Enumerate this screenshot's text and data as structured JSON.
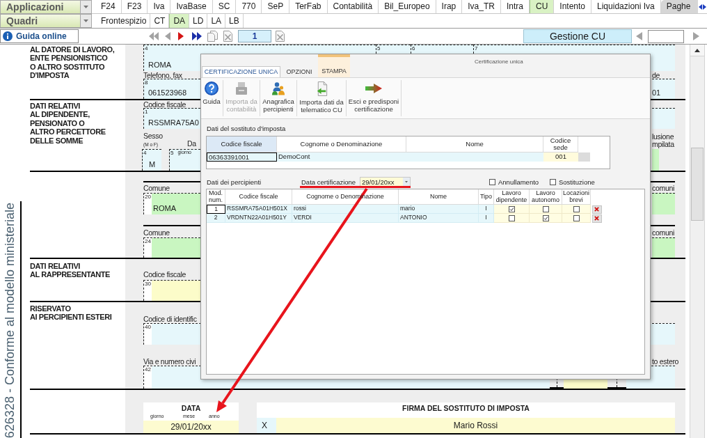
{
  "menu_bar": {
    "selector": "Applicazioni",
    "tabs": [
      {
        "label": "F24",
        "selected": false,
        "highlighted": false
      },
      {
        "label": "F23",
        "selected": false,
        "highlighted": false
      },
      {
        "label": "Iva",
        "selected": false,
        "highlighted": false
      },
      {
        "label": "IvaBase",
        "selected": false,
        "highlighted": false
      },
      {
        "label": "SC",
        "selected": false,
        "highlighted": false
      },
      {
        "label": "770",
        "selected": false,
        "highlighted": false
      },
      {
        "label": "SeP",
        "selected": false,
        "highlighted": false
      },
      {
        "label": "TerFab",
        "selected": false,
        "highlighted": false
      },
      {
        "label": "Contabilità",
        "selected": false,
        "highlighted": false
      },
      {
        "label": "Bil_Europeo",
        "selected": false,
        "highlighted": false
      },
      {
        "label": "Irap",
        "selected": false,
        "highlighted": false
      },
      {
        "label": "Iva_TR",
        "selected": false,
        "highlighted": false
      },
      {
        "label": "Intra",
        "selected": false,
        "highlighted": false
      },
      {
        "label": "CU",
        "selected": true,
        "highlighted": false
      },
      {
        "label": "Intento",
        "selected": false,
        "highlighted": false
      },
      {
        "label": "Liquidazioni Iva",
        "selected": false,
        "highlighted": false
      },
      {
        "label": "Paghe",
        "selected": false,
        "highlighted": true
      }
    ]
  },
  "sub_bar": {
    "selector": "Quadri",
    "tabs": [
      {
        "label": "Frontespizio",
        "selected": false
      },
      {
        "label": "CT",
        "selected": false
      },
      {
        "label": "DA",
        "selected": true
      },
      {
        "label": "LD",
        "selected": false
      },
      {
        "label": "LA",
        "selected": false
      },
      {
        "label": "LB",
        "selected": false
      }
    ]
  },
  "toolbar": {
    "help": "Guida online",
    "page": "1",
    "mode": "Gestione CU"
  },
  "margin_note": "626328 - Conforme al modello ministeriale",
  "form": {
    "employer": {
      "title": [
        "AL DATORE DI LAVORO,",
        "ENTE PENSIONISTICO",
        "O ALTRO SOSTITUTO",
        "D'IMPOSTA"
      ],
      "fields": [
        {
          "number": "4",
          "value": "ROMA"
        },
        {
          "number": "5"
        },
        {
          "number": "6"
        },
        {
          "number": "7"
        }
      ],
      "phone": {
        "label": "Telefono, fax",
        "number": "8",
        "value": "061523968"
      },
      "office": {
        "label": "de",
        "value": "01"
      }
    },
    "employee": {
      "title": [
        "DATI RELATIVI",
        "AL DIPENDENTE,",
        "PENSIONATO O",
        "ALTRO PERCETTORE",
        "DELLE SOMME"
      ],
      "tax_code": {
        "label": "Codice fiscale",
        "number": "1",
        "value": "RSSMRA75A0"
      },
      "sex": {
        "label": "Sesso",
        "hint": "(M o F)",
        "number": "4",
        "value": "M"
      },
      "birth": {
        "label": "Da",
        "number": "5",
        "hint": "giorno"
      },
      "side_label": [
        "lusione",
        "mpilata"
      ]
    },
    "residence": [
      {
        "label": "Comune",
        "number": "20",
        "value": "ROMA",
        "side_label": "comuni"
      },
      {
        "label": "Comune",
        "number": "24",
        "side_label": "comuni"
      }
    ],
    "representative": {
      "title": [
        "DATI RELATIVI",
        "AL RAPPRESENTANTE"
      ],
      "tax_code": {
        "label": "Codice fiscale",
        "number": "30"
      }
    },
    "foreign": {
      "title": [
        "RISERVATO",
        "AI PERCIPIENTI ESTERI"
      ],
      "id_code": {
        "label": "Codice di identific",
        "number": "40"
      },
      "address": {
        "label": "Via e numero civi",
        "number": "42",
        "side_label": "to estero"
      }
    }
  },
  "dialog": {
    "title": "Certificazione unica",
    "tabs": [
      {
        "label": "CERTIFICAZIONE UNICA",
        "selected": true,
        "highlighted": false
      },
      {
        "label": "OPZIONI",
        "selected": false,
        "highlighted": false
      },
      {
        "label": "STAMPA",
        "selected": false,
        "highlighted": true
      }
    ],
    "ribbon": [
      {
        "kind": "help",
        "label": "Guida",
        "disabled": false
      },
      {
        "kind": "import",
        "label": "Importa da contabilità",
        "disabled": true
      },
      {
        "kind": "people",
        "label": "Anagrafica percipienti",
        "disabled": false
      },
      {
        "kind": "file",
        "label": "Importa dati da telematico CU",
        "disabled": false
      },
      {
        "kind": "exit",
        "label": "Esci e predisponi certificazione",
        "disabled": false
      }
    ],
    "substitute": {
      "heading": "Dati del sostituto d'imposta",
      "columns": [
        "Codice fiscale",
        "Cognome o Denominazione",
        "Nome",
        "Codice sede"
      ],
      "row": {
        "tax_code": "06363391001",
        "name": "DemoCont",
        "office": "001",
        "focused": true
      }
    },
    "recipients": {
      "heading": "Dati dei percipienti",
      "date_label": "Data certificazione",
      "date": "29/01/20xx",
      "options": [
        {
          "label": "Annullamento",
          "checked": false
        },
        {
          "label": "Sostituzione",
          "checked": false
        }
      ],
      "columns": [
        "Mod. num.",
        "Codice fiscale",
        "Cognome o Denominazione",
        "Nome",
        "Tipo",
        "Lavoro dipendente",
        "Lavoro autonomo",
        "Locazioni brevi"
      ],
      "rows": [
        {
          "number": "1",
          "tax_code": "RSSMRA75A01H501X",
          "surname": "rossi",
          "name": "mario",
          "type": "I",
          "employee": true,
          "self_employed": false,
          "short_rental": false,
          "focused": true
        },
        {
          "number": "2",
          "tax_code": "VRDNTN22A01H501Y",
          "surname": "VERDI",
          "name": "ANTONIO",
          "type": "I",
          "employee": false,
          "self_employed": true,
          "short_rental": false,
          "focused": false
        }
      ]
    }
  },
  "footer": {
    "date": {
      "title": "DATA",
      "parts": [
        "giorno",
        "mese",
        "anno"
      ],
      "value": "29/01/20xx"
    },
    "signature": {
      "title": "FIRMA DEL SOSTITUTO DI IMPOSTA",
      "mark": "X",
      "value": "Mario Rossi"
    }
  }
}
